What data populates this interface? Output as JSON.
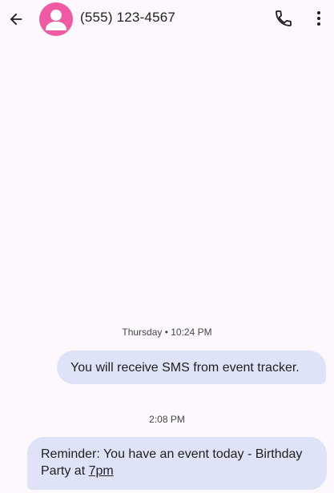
{
  "header": {
    "title": "(555) 123-4567",
    "back_icon": "arrow-back-icon",
    "avatar_icon": "person-icon",
    "avatar_color": "#f05aa3",
    "call_icon": "phone-icon",
    "more_icon": "more-vert-icon"
  },
  "conversation": {
    "groups": [
      {
        "timestamp": "Thursday • 10:24 PM",
        "message": {
          "direction": "outgoing",
          "text": "You will receive SMS from event tracker."
        }
      },
      {
        "timestamp": "2:08 PM",
        "message": {
          "direction": "incoming",
          "text_before_link": "Reminder: You have an event today - Birthday Party at ",
          "link_text": "7pm"
        }
      }
    ]
  },
  "colors": {
    "background": "#fdf8fd",
    "bubble": "#dfe3f7"
  }
}
